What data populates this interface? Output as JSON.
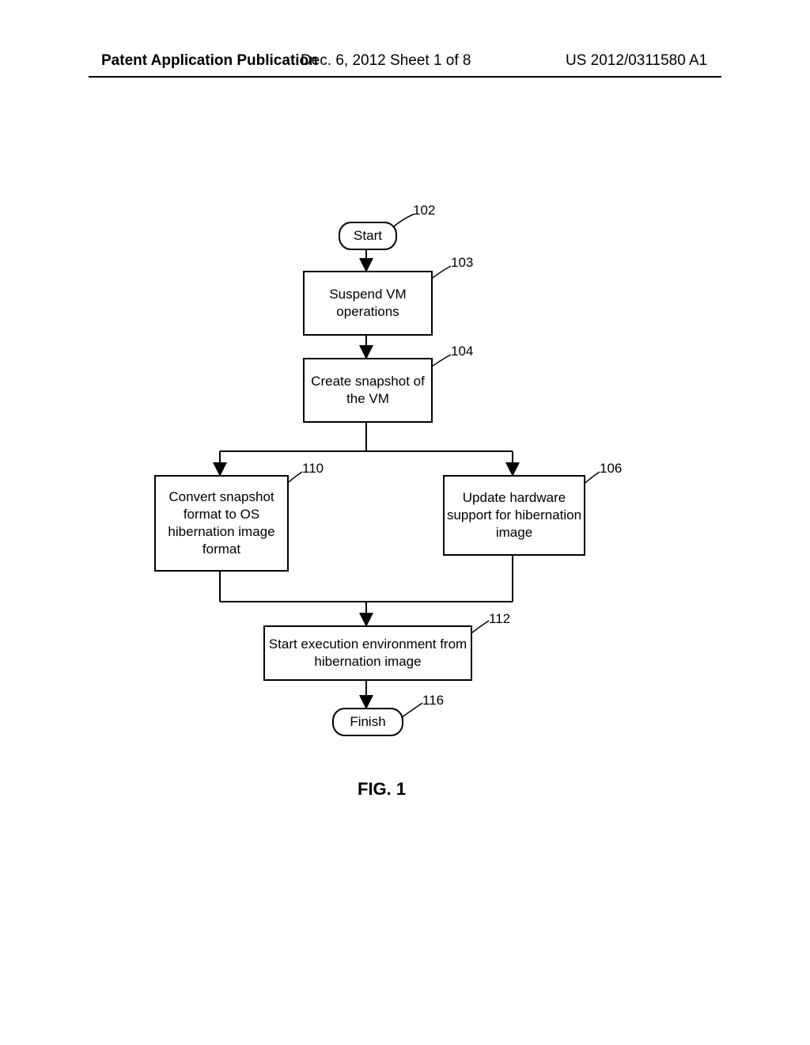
{
  "header": {
    "left": "Patent Application Publication",
    "center": "Dec. 6, 2012  Sheet 1 of 8",
    "right": "US 2012/0311580 A1"
  },
  "chart_data": {
    "type": "flowchart",
    "title": "FIG. 1",
    "nodes": [
      {
        "id": "102",
        "type": "terminator",
        "text": "Start",
        "ref": "102"
      },
      {
        "id": "103",
        "type": "process",
        "text": "Suspend VM operations",
        "ref": "103"
      },
      {
        "id": "104",
        "type": "process",
        "text": "Create snapshot of the VM",
        "ref": "104"
      },
      {
        "id": "110",
        "type": "process",
        "text": "Convert snapshot format to OS hibernation image format",
        "ref": "110"
      },
      {
        "id": "106",
        "type": "process",
        "text": "Update hardware support for hibernation image",
        "ref": "106"
      },
      {
        "id": "112",
        "type": "process",
        "text": "Start execution environment from hibernation image",
        "ref": "112"
      },
      {
        "id": "116",
        "type": "terminator",
        "text": "Finish",
        "ref": "116"
      }
    ],
    "edges": [
      {
        "from": "102",
        "to": "103"
      },
      {
        "from": "103",
        "to": "104"
      },
      {
        "from": "104",
        "to": "110"
      },
      {
        "from": "104",
        "to": "106"
      },
      {
        "from": "110",
        "to": "112"
      },
      {
        "from": "106",
        "to": "112"
      },
      {
        "from": "112",
        "to": "116"
      }
    ]
  }
}
